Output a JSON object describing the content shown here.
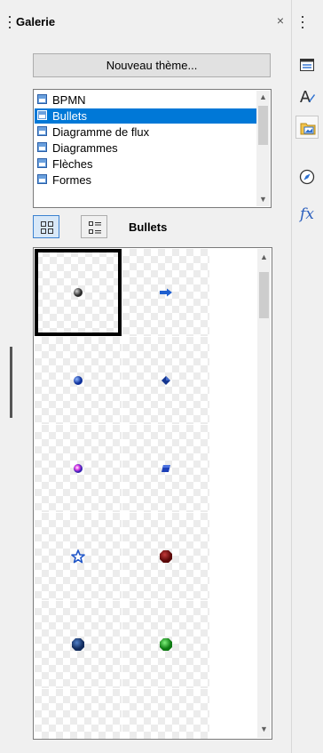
{
  "panel": {
    "title": "Galerie",
    "close_symbol": "×",
    "new_theme_label": "Nouveau thème...",
    "themes": [
      {
        "label": "BPMN",
        "selected": false
      },
      {
        "label": "Bullets",
        "selected": true
      },
      {
        "label": "Diagramme de flux",
        "selected": false
      },
      {
        "label": "Diagrammes",
        "selected": false
      },
      {
        "label": "Flèches",
        "selected": false
      },
      {
        "label": "Formes",
        "selected": false
      }
    ],
    "view_label": "Bullets",
    "view_modes": [
      "icon-view",
      "detail-view"
    ],
    "gallery_items": [
      {
        "name": "gray-sphere-bullet",
        "color": "#555555"
      },
      {
        "name": "blue-arrow-bullet",
        "color": "#1f5fcf"
      },
      {
        "name": "blue-sphere-bullet",
        "color": "#1c4fd0"
      },
      {
        "name": "blue-diamond-bullet",
        "color": "#14358f"
      },
      {
        "name": "magenta-sphere-bullet",
        "color": "#c21ec8"
      },
      {
        "name": "blue-cube-bullet",
        "color": "#1c3fb8"
      },
      {
        "name": "blue-star-bullet",
        "color": "#1f55c8"
      },
      {
        "name": "dark-red-octagon-bullet",
        "color": "#7a0c0c"
      },
      {
        "name": "navy-octagon-bullet",
        "color": "#1a3f80"
      },
      {
        "name": "green-octagon-bullet",
        "color": "#19a31f"
      }
    ]
  },
  "sidebar": {
    "buttons": [
      {
        "name": "properties-icon",
        "active": false
      },
      {
        "name": "styles-icon",
        "active": false
      },
      {
        "name": "gallery-icon",
        "active": true
      },
      {
        "name": "navigator-icon",
        "active": false
      },
      {
        "name": "functions-icon",
        "active": false,
        "label": "fx"
      }
    ]
  },
  "colors": {
    "selection": "#0078d7",
    "accent": "#3c82d0"
  }
}
